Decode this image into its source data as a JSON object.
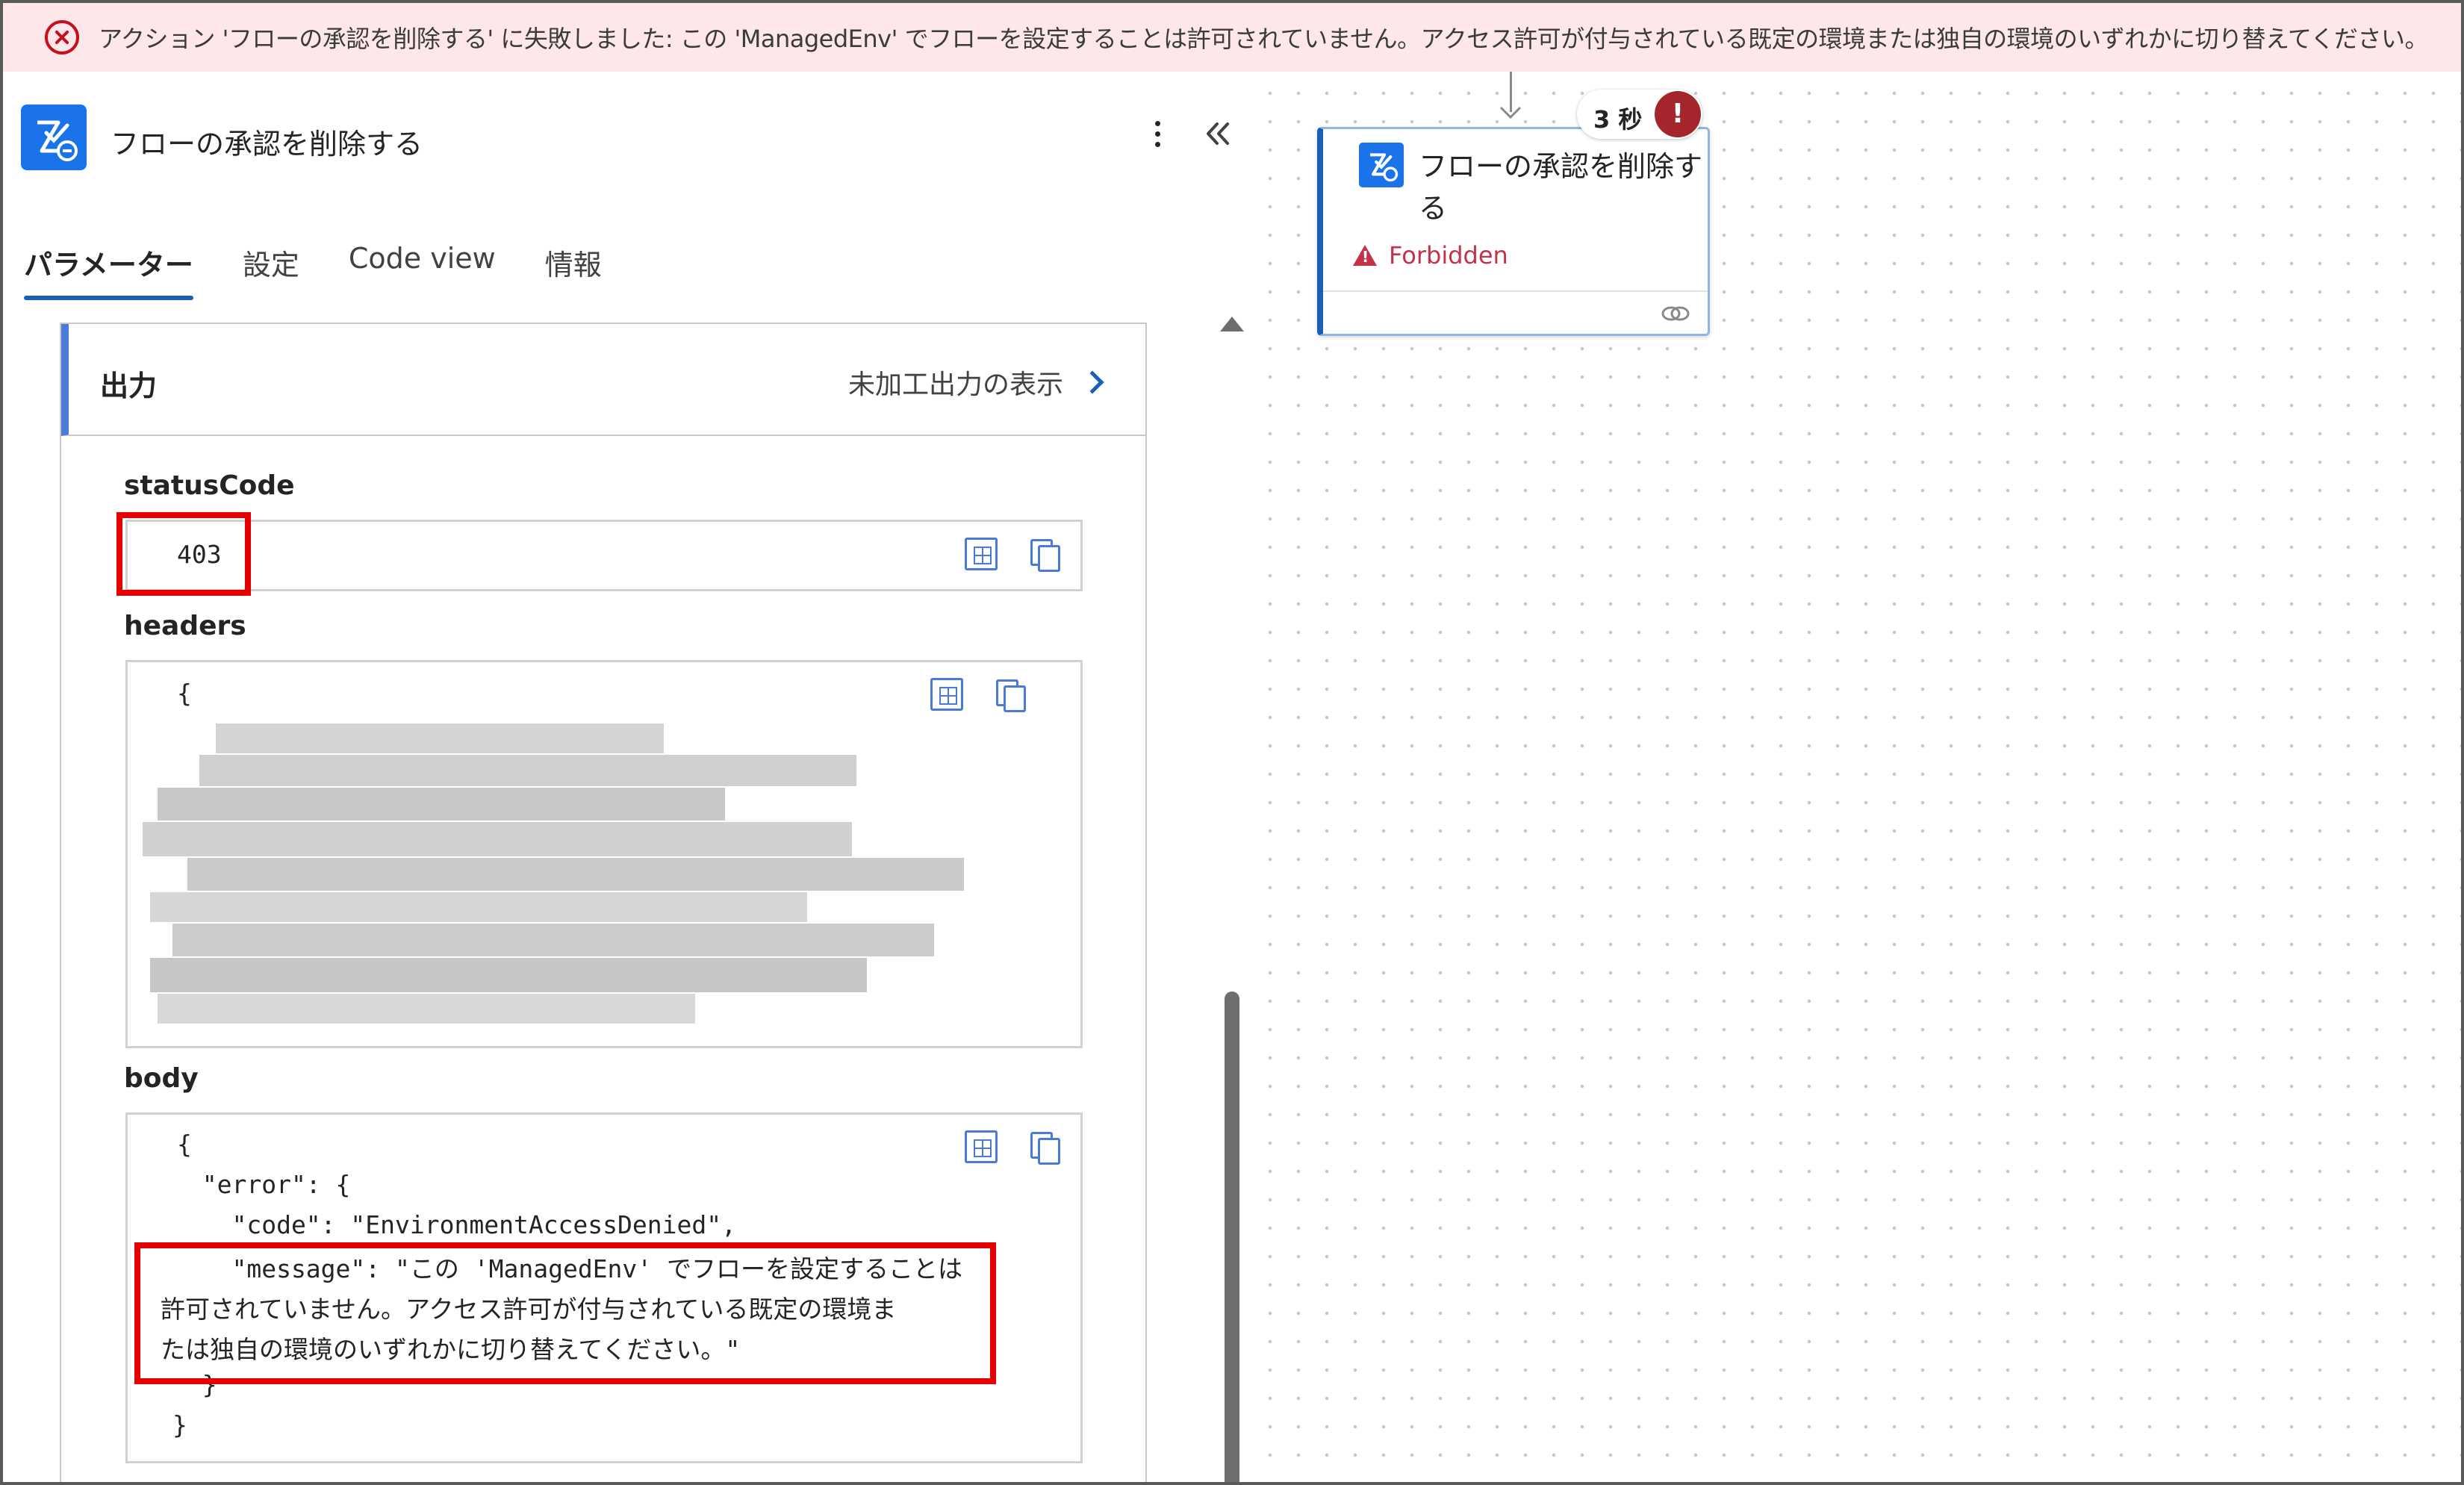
{
  "banner": {
    "message": "アクション 'フローの承認を削除する' に失敗しました: この 'ManagedEnv' でフローを設定することは許可されていません。アクセス許可が付与されている既定の環境または独自の環境のいずれかに切り替えてください。",
    "icon": "error-circle-icon",
    "color": "#c50f1f"
  },
  "panel": {
    "title": "フローの承認を削除する",
    "tabs": [
      {
        "label": "パラメーター",
        "active": true
      },
      {
        "label": "設定",
        "active": false
      },
      {
        "label": "Code view",
        "active": false
      },
      {
        "label": "情報",
        "active": false
      }
    ],
    "output": {
      "title": "出力",
      "raw_link": "未加工出力の表示",
      "status_label": "statusCode",
      "status_value": "403",
      "headers_label": "headers",
      "headers_open": "{",
      "body_label": "body",
      "body_lines": [
        "{",
        "  \"error\": {",
        "    \"code\": \"EnvironmentAccessDenied\",",
        "    \"message\": \"この 'ManagedEnv' でフローを設定することは",
        "許可されていません。アクセス許可が付与されている既定の環境ま",
        "たは独自の環境のいずれかに切り替えてください。\"",
        "  }",
        "}"
      ]
    }
  },
  "node": {
    "title": "フローの承認を削除する",
    "status": "Forbidden",
    "duration": "3 秒",
    "error_badge": "!"
  },
  "colors": {
    "accent": "#1a5fb4",
    "error": "#c4314b",
    "highlight": "#e60000"
  }
}
